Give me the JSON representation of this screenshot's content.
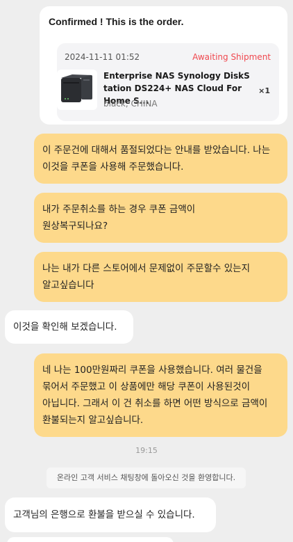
{
  "order_card": {
    "title": "Confirmed ! This is the order.",
    "date": "2024-11-11 01:52",
    "status": "Awaiting Shipment",
    "product": {
      "name": "Enterprise NAS Synology DiskStation DS224+ NAS Cloud For Home S...",
      "variant": "black, CHINA",
      "quantity": "×1",
      "thumbnail_icon": "nas-device-icon"
    }
  },
  "messages": [
    {
      "sender": "user",
      "text": "이 주문건에 대해서 품절되었다는 안내를 받았습니다. 나는 이것을 쿠폰을 사용해 주문했습니다."
    },
    {
      "sender": "user",
      "text": "내가 주문취소를 하는 경우 쿠폰 금액이 원상복구되나요?"
    },
    {
      "sender": "user",
      "text": "나는 내가 다른 스토어에서 문제없이 주문할수 있는지 알고싶습니다"
    },
    {
      "sender": "agent",
      "text": "이것을 확인해 보겠습니다."
    },
    {
      "sender": "user",
      "text": "네 나는 100만원짜리 쿠폰을 사용했습니다. 여러 물건을 묶어서 주문했고 이 상품에만 해당 쿠폰이 사용된것이 아닙니다. 그래서 이 건 취소를 하면 어떤 방식으로 금액이 환불되는지 알고싶습니다."
    },
    {
      "sender": "agent",
      "text": "고객님의 은행으로 환불을 받으실 수 있습니다."
    }
  ],
  "timestamp": "19:15",
  "system_notice": "온라인 고객 서비스 채팅창에 돌아오신 것을 환영합니다.",
  "colors": {
    "background": "#eeeeee",
    "user_bubble": "#fdd98b",
    "agent_bubble": "#ffffff",
    "status_red": "#f0484f"
  }
}
